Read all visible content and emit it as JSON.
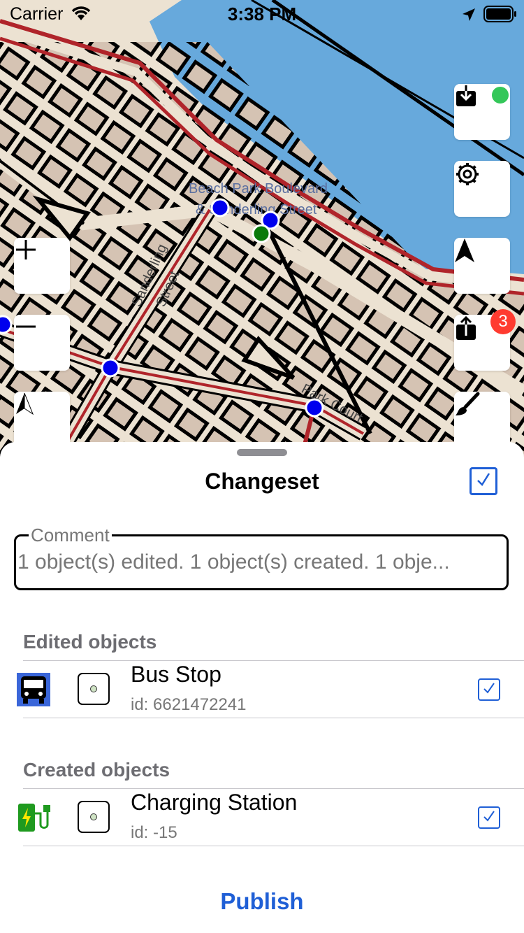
{
  "status_bar": {
    "carrier": "Carrier",
    "time": "3:38 PM"
  },
  "map": {
    "labels": {
      "road1_line1": "Beach Park Boulevard",
      "road1_line2": "& Sanderling Street",
      "road2_line1": "Sanderling",
      "road2_line2": "Street",
      "road3": "Park Court"
    },
    "upload_badge_count": "3",
    "colors": {
      "water": "#67a9dc",
      "land": "#ece2d2",
      "building": "#d5c3b3",
      "road": "#b0242a",
      "node_blue": "#0000ee",
      "node_green": "#0a7a0a"
    }
  },
  "sheet": {
    "title": "Changeset",
    "comment_label": "Comment",
    "comment_value": "1 object(s) edited. 1 object(s) created. 1 obje...",
    "sections": [
      {
        "header": "Edited objects",
        "items": [
          {
            "title": "Bus Stop",
            "subtitle": "id: 6621472241",
            "icon": "bus-icon",
            "checked": true
          }
        ]
      },
      {
        "header": "Created objects",
        "items": [
          {
            "title": "Charging Station",
            "subtitle": "id: -15",
            "icon": "charging-station-icon",
            "checked": true
          }
        ]
      }
    ],
    "publish_label": "Publish",
    "accent_color": "#1f5fd6"
  }
}
